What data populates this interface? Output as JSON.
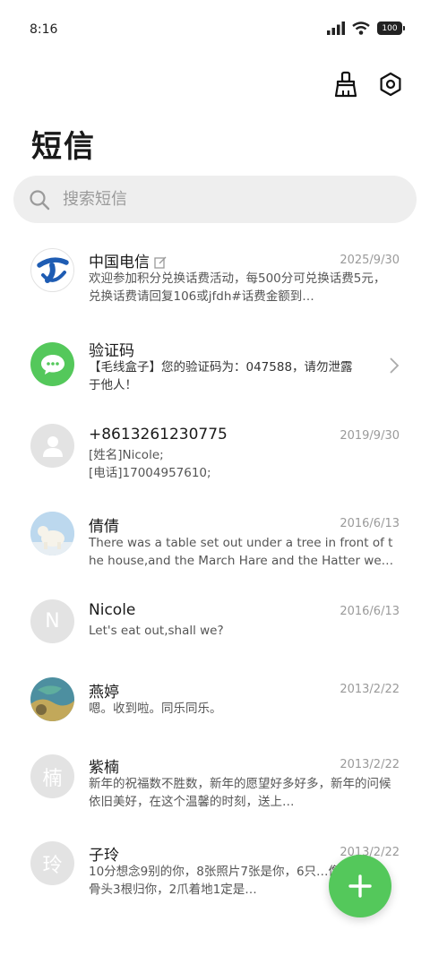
{
  "status_bar": {
    "time": "8:16",
    "battery": "100"
  },
  "header": {
    "title": "短信"
  },
  "search": {
    "placeholder": "搜索短信"
  },
  "conversations": [
    {
      "name": "中国电信",
      "date": "2025/9/30",
      "preview": "欢迎参加积分兑换话费活动，每500分可兑换话费5元，兑换话费请回复106或jfdh#话费金额到…",
      "avatar_icon": "china-telecom-logo"
    },
    {
      "name": "验证码",
      "date": "",
      "preview": "【毛线盒子】您的验证码为：047588，请勿泄露于他人！",
      "avatar_icon": "message-bubble-icon"
    },
    {
      "name": "+8613261230775",
      "date": "2019/9/30",
      "preview": "[姓名]Nicole;\n[电话]17004957610;",
      "avatar_icon": "person-icon"
    },
    {
      "name": "倩倩",
      "date": "2016/6/13",
      "preview": "There was a table set out under a tree in front of the house,and the March Hare and the Hatter wer…",
      "avatar_icon": "polar-bear-photo"
    },
    {
      "name": "Nicole",
      "date": "2016/6/13",
      "preview": "Let's eat out,shall we?",
      "avatar_letter": "N"
    },
    {
      "name": "燕婷",
      "date": "2013/2/22",
      "preview": "嗯。收到啦。同乐同乐。",
      "avatar_icon": "landscape-photo"
    },
    {
      "name": "紫楠",
      "date": "2013/2/22",
      "preview": "新年的祝福数不胜数，新年的愿望好多好多，新年的问候依旧美好，在这个温馨的时刻，送上…",
      "avatar_letter": "楠"
    },
    {
      "name": "子玲",
      "date": "2013/2/22",
      "preview": "10分想念9别的你，8张照片7张是你，6只…像你，4根骨头3根归你，2爪着地1定是…",
      "avatar_letter": "玲"
    }
  ],
  "colors": {
    "accent": "#54c85b",
    "telecom_blue": "#1e5cb3",
    "avatar_gray": "#e3e3e3"
  }
}
